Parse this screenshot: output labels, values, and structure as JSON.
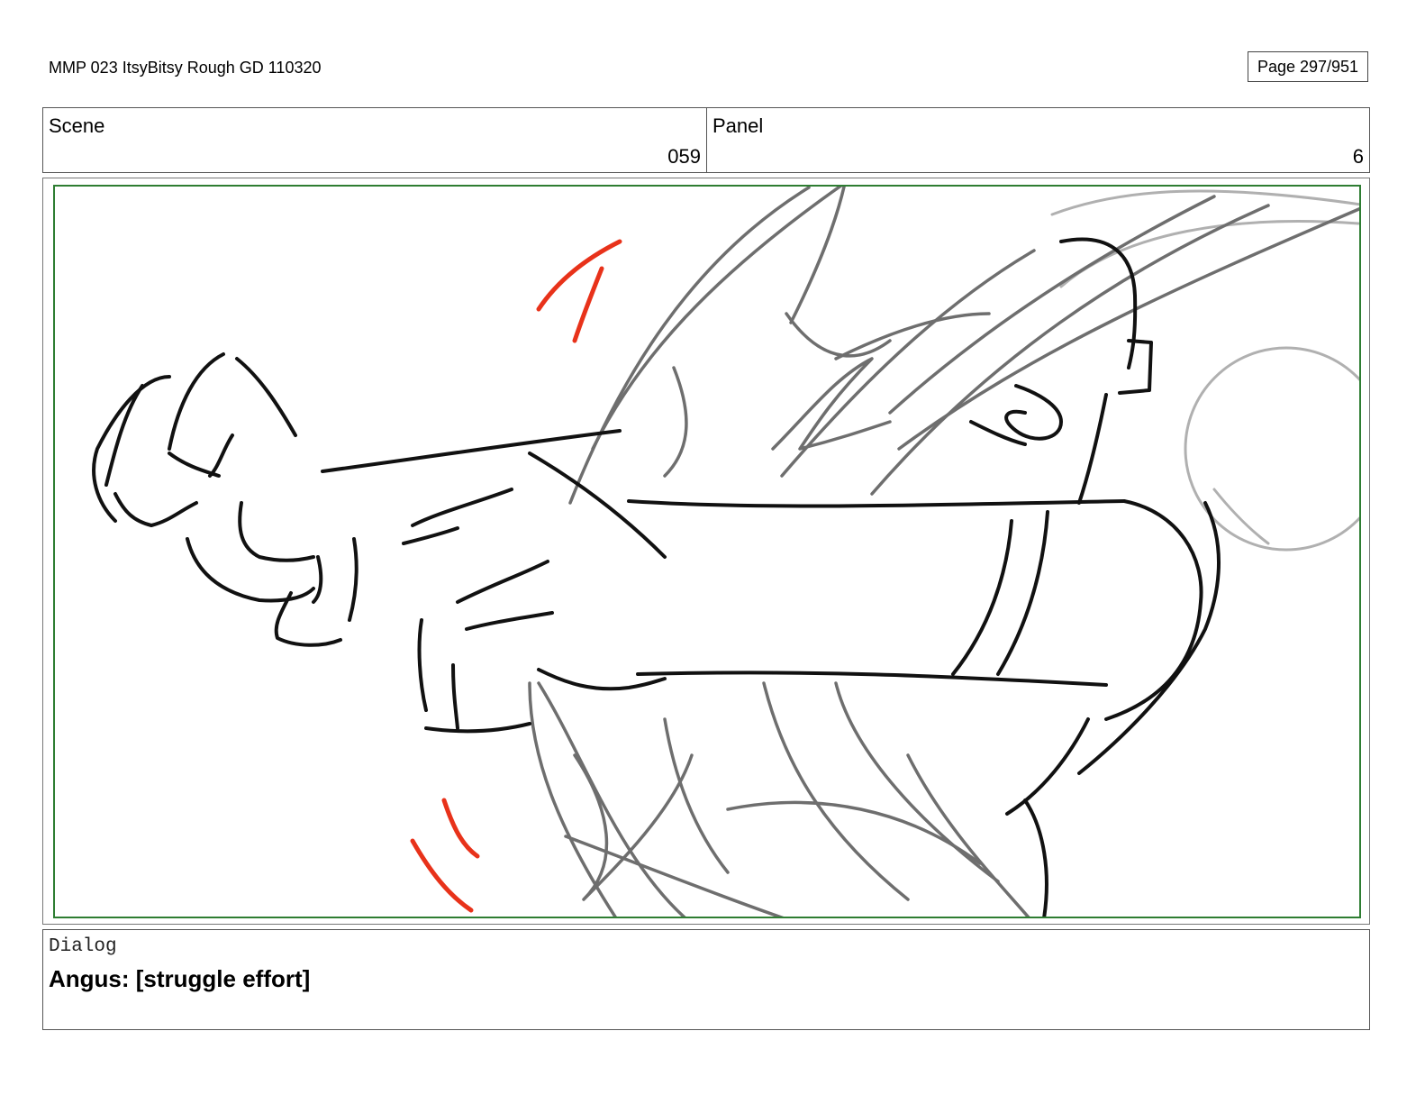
{
  "header": {
    "document_title": "MMP 023 ItsyBitsy Rough GD 110320",
    "page_indicator": "Page 297/951"
  },
  "info": {
    "scene_label": "Scene",
    "scene_value": "059",
    "panel_label": "Panel",
    "panel_value": "6"
  },
  "artwork": {
    "safe_frame_color": "#2e7d32",
    "ink_color": "#111111",
    "rough_color": "#6e6e6e",
    "light_rough_color": "#b0b0b0",
    "effect_color": "#e8321a"
  },
  "dialog": {
    "label": "Dialog",
    "text": "Angus: [struggle effort]"
  }
}
